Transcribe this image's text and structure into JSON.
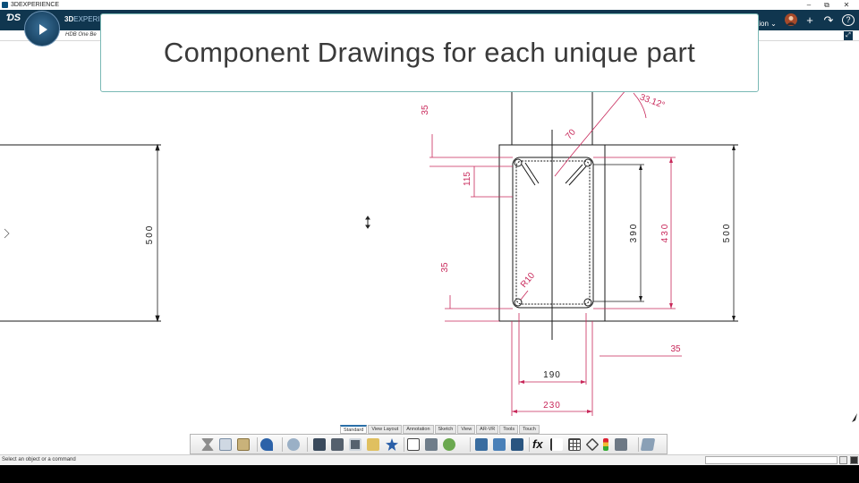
{
  "window": {
    "title": "3DEXPERIENCE",
    "minimize": "–",
    "restore": "⧉",
    "close": "✕"
  },
  "appbar": {
    "brand_bold": "3D",
    "brand_thin": "EXPERIE",
    "right_text": "tion",
    "right_chevron": "⌄",
    "add": "+",
    "share": "↷",
    "help": "?"
  },
  "subbar": {
    "doc_title": "HDB One Be",
    "maximize": "⤢"
  },
  "banner": {
    "text": "Component Drawings for each unique part"
  },
  "drawing": {
    "dims": {
      "d35_top": "35",
      "d70": "70",
      "angle": "33.12°",
      "d115": "115",
      "d390": "390",
      "d430": "430",
      "d500_right": "500",
      "d500_left": "500",
      "d35_mid": "35",
      "r10": "R10",
      "d35_right": "35",
      "d190": "190",
      "d230": "230"
    },
    "dim_color": "#c8285a",
    "line_color": "#1a1a1a"
  },
  "toolbar": {
    "tabs": [
      {
        "label": "Standard",
        "active": true
      },
      {
        "label": "View Layout",
        "active": false
      },
      {
        "label": "Annotation",
        "active": false
      },
      {
        "label": "Sketch",
        "active": false
      },
      {
        "label": "View",
        "active": false
      },
      {
        "label": "AR-VR",
        "active": false
      },
      {
        "label": "Tools",
        "active": false
      },
      {
        "label": "Touch",
        "active": false
      }
    ]
  },
  "statusbar": {
    "message": "Select an object or a command"
  }
}
